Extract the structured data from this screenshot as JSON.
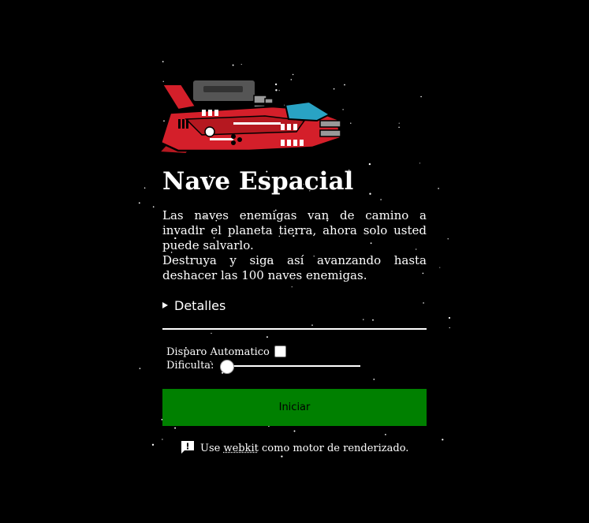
{
  "game": {
    "title": "Nave Espacial",
    "description": [
      "Las naves enemigas van de camino a invadir el planeta tierra, ahora solo usted puede salvarlo.",
      "Destruya y siga así avanzando hasta deshacer las 100 naves enemigas."
    ],
    "details_label": "Detalles",
    "options": {
      "auto_fire_label": "Disparo Automatico",
      "auto_fire_checked": false,
      "difficulty_label": "Dificulta:",
      "difficulty_value": 0
    },
    "start_label": "Iniciar",
    "footer": {
      "prefix": "Use",
      "engine": "webkit",
      "suffix": "como motor de renderizado."
    }
  },
  "colors": {
    "background": "#000000",
    "start_button": "#008000",
    "ship_red": "#d41f2a",
    "ship_cockpit": "#29a3c4"
  },
  "icons": {
    "footer": "feedback-alert-icon",
    "details": "disclosure-triangle-icon"
  }
}
